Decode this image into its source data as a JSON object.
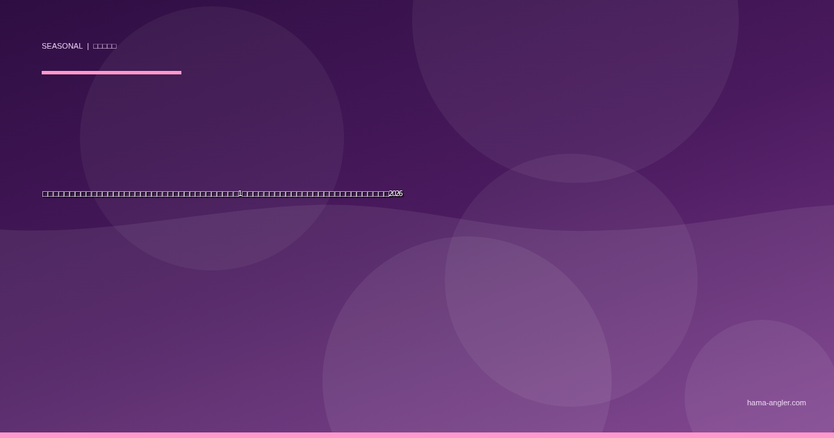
{
  "category": {
    "label": "SEASONAL",
    "separator": "|",
    "name": "□□□□□"
  },
  "title": "□□□□□□□□□□□□□□□□□□□□□□□□□□□□□□□□□□□□1□□□□□□□□□□□□□□□□□□□□□□□□□□□2026",
  "site": "hama-angler.com"
}
